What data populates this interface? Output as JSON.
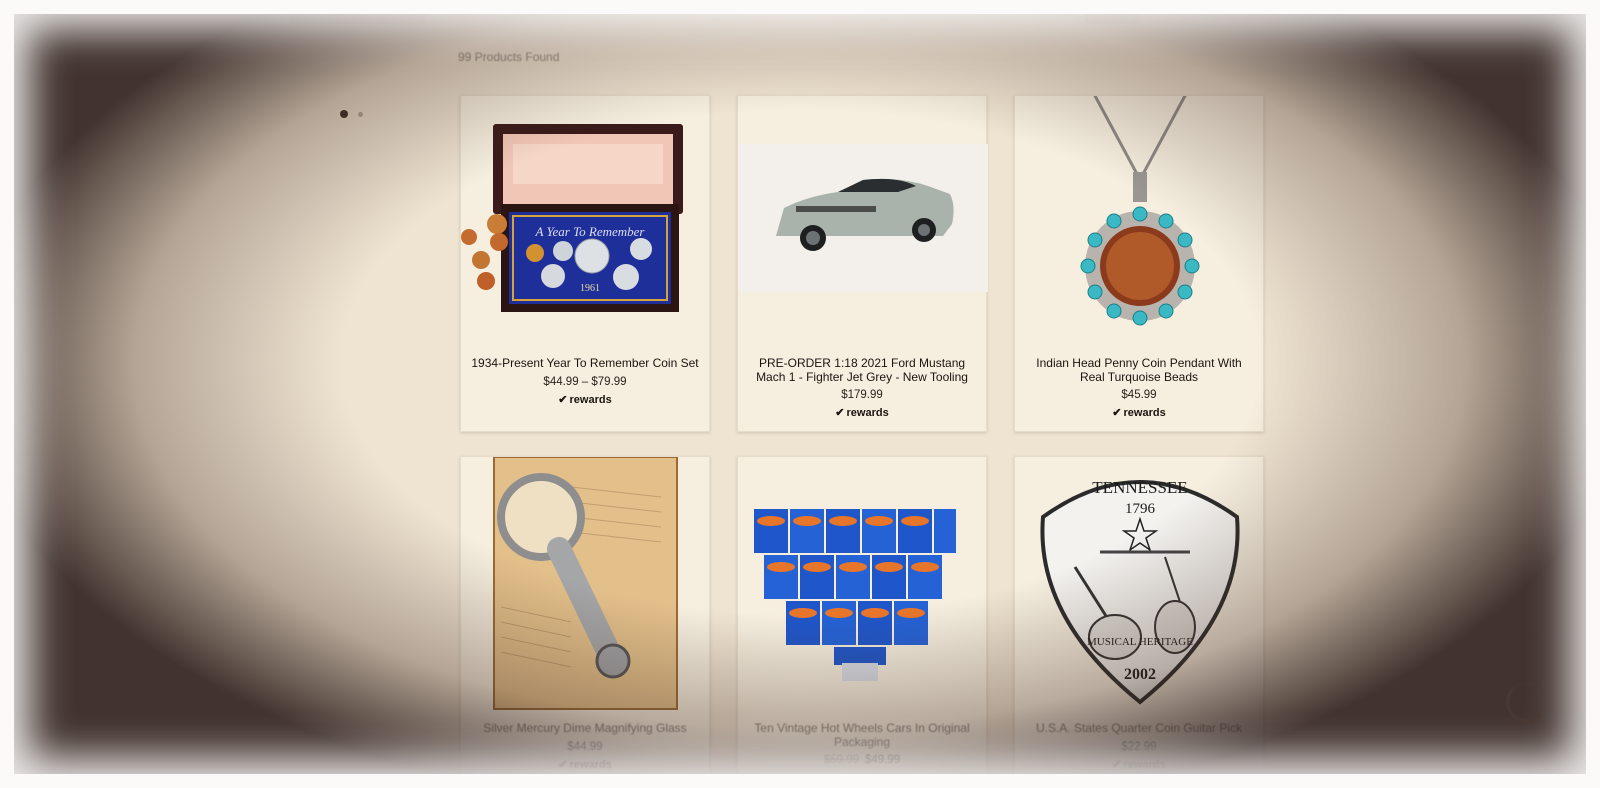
{
  "results": {
    "count_text": "99 Products Found"
  },
  "products": [
    {
      "title": "1934-Present Year To Remember Coin Set",
      "price": "$44.99 – $79.99",
      "old_price": "",
      "rewards": "rewards"
    },
    {
      "title": "PRE-ORDER 1:18 2021 Ford Mustang Mach 1 - Fighter Jet Grey - New Tooling",
      "price": "$179.99",
      "old_price": "",
      "rewards": "rewards"
    },
    {
      "title": "Indian Head Penny Coin Pendant With Real Turquoise Beads",
      "price": "$45.99",
      "old_price": "",
      "rewards": "rewards"
    },
    {
      "title": "Silver Mercury Dime Magnifying Glass",
      "price": "$44.99",
      "old_price": "",
      "rewards": "rewards"
    },
    {
      "title": "Ten Vintage Hot Wheels Cars In Original Packaging",
      "price": "$49.99",
      "old_price": "$59.99",
      "rewards": ""
    },
    {
      "title": "U.S.A. States Quarter Coin Guitar Pick",
      "price": "$22.99",
      "old_price": "",
      "rewards": "rewards"
    }
  ],
  "art_text": {
    "coin_set_banner": "A Year To Remember",
    "coin_set_year": "1961",
    "pick_state": "TENNESSEE",
    "pick_year_top": "1796",
    "pick_motto": "MUSICAL HERITAGE",
    "pick_year_bottom": "2002"
  },
  "icons": {
    "rewards_icon": "check-circle-icon"
  },
  "colors": {
    "page_bg": "#efe4d2",
    "card_bg": "#f6efdf",
    "vignette": "#2a1a16"
  }
}
